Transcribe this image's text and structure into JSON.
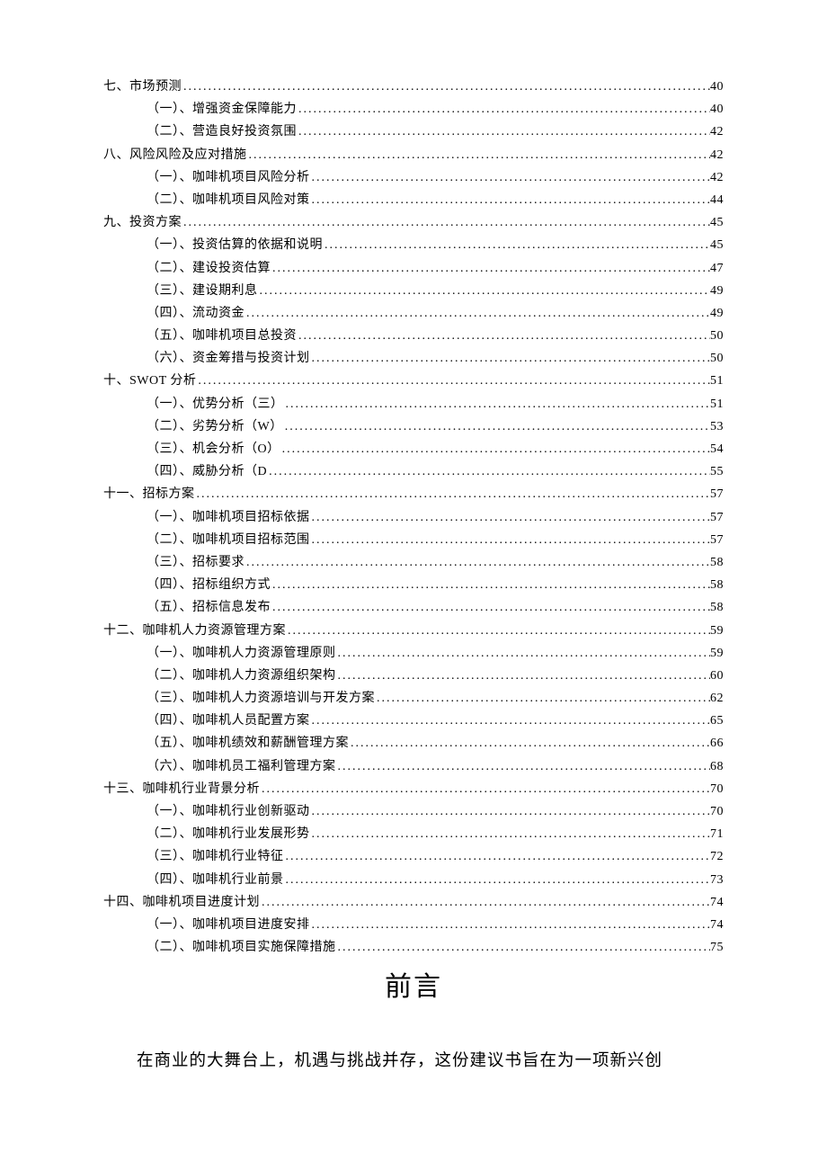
{
  "toc": [
    {
      "level": 1,
      "label": "七、市场预测",
      "page": "40"
    },
    {
      "level": 2,
      "label": "（一）、增强资金保障能力",
      "page": "40"
    },
    {
      "level": 2,
      "label": "（二）、营造良好投资氛围",
      "page": "42"
    },
    {
      "level": 1,
      "label": "八、风险风险及应对措施",
      "page": "42"
    },
    {
      "level": 2,
      "label": "（一）、咖啡机项目风险分析",
      "page": "42"
    },
    {
      "level": 2,
      "label": "（二）、咖啡机项目风险对策",
      "page": "44"
    },
    {
      "level": 1,
      "label": "九、投资方案",
      "page": "45"
    },
    {
      "level": 2,
      "label": "（一）、投资估算的依据和说明",
      "page": "45"
    },
    {
      "level": 2,
      "label": "（二）、建设投资估算",
      "page": "47"
    },
    {
      "level": 2,
      "label": "（三）、建设期利息",
      "page": "49"
    },
    {
      "level": 2,
      "label": "（四）、流动资金",
      "page": "49"
    },
    {
      "level": 2,
      "label": "（五）、咖啡机项目总投资",
      "page": "50"
    },
    {
      "level": 2,
      "label": "（六）、资金筹措与投资计划",
      "page": "50"
    },
    {
      "level": 1,
      "label": "十、SWOT 分析",
      "page": "51"
    },
    {
      "level": 2,
      "label": "（一）、优势分析（三）",
      "page": "51"
    },
    {
      "level": 2,
      "label": "（二）、劣势分析（W）",
      "page": "53"
    },
    {
      "level": 2,
      "label": "（三）、机会分析（O）",
      "page": "54"
    },
    {
      "level": 2,
      "label": "（四）、威胁分析（D",
      "page": "55"
    },
    {
      "level": 1,
      "label": "十一、招标方案",
      "page": "57"
    },
    {
      "level": 2,
      "label": "（一）、咖啡机项目招标依据",
      "page": "57"
    },
    {
      "level": 2,
      "label": "（二）、咖啡机项目招标范围",
      "page": "57"
    },
    {
      "level": 2,
      "label": "（三）、招标要求",
      "page": "58"
    },
    {
      "level": 2,
      "label": "（四）、招标组织方式",
      "page": "58"
    },
    {
      "level": 2,
      "label": "（五）、招标信息发布",
      "page": "58"
    },
    {
      "level": 1,
      "label": "十二、咖啡机人力资源管理方案",
      "page": "59"
    },
    {
      "level": 2,
      "label": "（一）、咖啡机人力资源管理原则",
      "page": "59"
    },
    {
      "level": 2,
      "label": "（二）、咖啡机人力资源组织架构",
      "page": "60"
    },
    {
      "level": 2,
      "label": "（三）、咖啡机人力资源培训与开发方案",
      "page": "62"
    },
    {
      "level": 2,
      "label": "（四）、咖啡机人员配置方案",
      "page": "65"
    },
    {
      "level": 2,
      "label": "（五）、咖啡机绩效和薪酬管理方案",
      "page": "66"
    },
    {
      "level": 2,
      "label": "（六）、咖啡机员工福利管理方案",
      "page": "68"
    },
    {
      "level": 1,
      "label": "十三、咖啡机行业背景分析",
      "page": "70"
    },
    {
      "level": 2,
      "label": "（一）、咖啡机行业创新驱动",
      "page": "70"
    },
    {
      "level": 2,
      "label": "（二）、咖啡机行业发展形势",
      "page": "71"
    },
    {
      "level": 2,
      "label": "（三）、咖啡机行业特征",
      "page": "72"
    },
    {
      "level": 2,
      "label": "（四）、咖啡机行业前景",
      "page": "73"
    },
    {
      "level": 1,
      "label": "十四、咖啡机项目进度计划",
      "page": "74"
    },
    {
      "level": 2,
      "label": "（一）、咖啡机项目进度安排",
      "page": "74"
    },
    {
      "level": 2,
      "label": "（二）、咖啡机项目实施保障措施",
      "page": "75"
    }
  ],
  "heading": "前言",
  "body_paragraph": "在商业的大舞台上，机遇与挑战并存，这份建议书旨在为一项新兴创"
}
